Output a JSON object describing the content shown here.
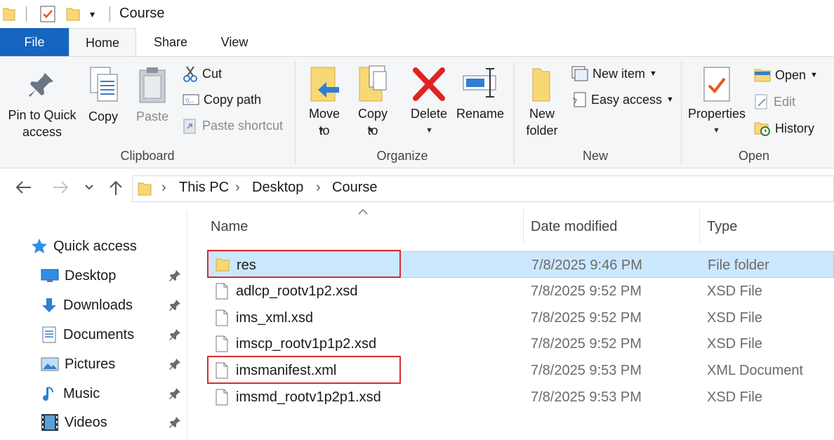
{
  "window": {
    "title": "Course"
  },
  "tabs": [
    {
      "label": "File"
    },
    {
      "label": "Home"
    },
    {
      "label": "Share"
    },
    {
      "label": "View"
    }
  ],
  "ribbon": {
    "clipboard": {
      "group_label": "Clipboard",
      "pin_label": "Pin to Quick access",
      "copy_label": "Copy",
      "paste_label": "Paste",
      "cut_label": "Cut",
      "copy_path_label": "Copy path",
      "paste_shortcut_label": "Paste shortcut"
    },
    "organize": {
      "group_label": "Organize",
      "move_to_label": "Move to",
      "copy_to_label": "Copy to",
      "delete_label": "Delete",
      "rename_label": "Rename"
    },
    "new": {
      "group_label": "New",
      "new_folder_label": "New folder",
      "new_item_label": "New item",
      "easy_access_label": "Easy access"
    },
    "open": {
      "group_label": "Open",
      "properties_label": "Properties",
      "open_label": "Open",
      "edit_label": "Edit",
      "history_label": "History"
    }
  },
  "breadcrumb": [
    "This PC",
    "Desktop",
    "Course"
  ],
  "sidebar": {
    "quick_access": "Quick access",
    "items": [
      {
        "label": "Desktop",
        "icon": "desktop-icon"
      },
      {
        "label": "Downloads",
        "icon": "downloads-icon"
      },
      {
        "label": "Documents",
        "icon": "documents-icon"
      },
      {
        "label": "Pictures",
        "icon": "pictures-icon"
      },
      {
        "label": "Music",
        "icon": "music-icon"
      },
      {
        "label": "Videos",
        "icon": "videos-icon"
      }
    ]
  },
  "columns": {
    "name": "Name",
    "date": "Date modified",
    "type": "Type"
  },
  "files": [
    {
      "name": "res",
      "date": "7/8/2025 9:46 PM",
      "type": "File folder",
      "kind": "folder",
      "selected": true,
      "highlighted": true
    },
    {
      "name": "adlcp_rootv1p2.xsd",
      "date": "7/8/2025 9:52 PM",
      "type": "XSD File",
      "kind": "file"
    },
    {
      "name": "ims_xml.xsd",
      "date": "7/8/2025 9:52 PM",
      "type": "XSD File",
      "kind": "file"
    },
    {
      "name": "imscp_rootv1p1p2.xsd",
      "date": "7/8/2025 9:52 PM",
      "type": "XSD File",
      "kind": "file"
    },
    {
      "name": "imsmanifest.xml",
      "date": "7/8/2025 9:53 PM",
      "type": "XML Document",
      "kind": "file",
      "highlighted": true
    },
    {
      "name": "imsmd_rootv1p2p1.xsd",
      "date": "7/8/2025 9:53 PM",
      "type": "XSD File",
      "kind": "file"
    }
  ],
  "colors": {
    "accent": "#1565c0",
    "selection": "#cce8ff",
    "highlight_box": "#d32f2f",
    "folder": "#f8d775"
  }
}
